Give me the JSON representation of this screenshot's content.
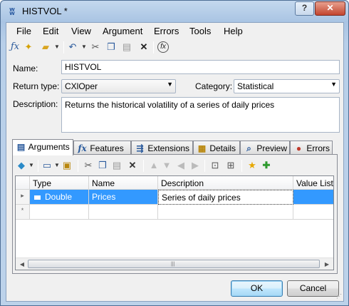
{
  "window": {
    "title": "HISTVOL *"
  },
  "titlebar_buttons": {
    "help": "?",
    "close": "✕"
  },
  "menu": [
    "File",
    "Edit",
    "View",
    "Argument",
    "Errors",
    "Tools",
    "Help"
  ],
  "form": {
    "name_label": "Name:",
    "name_value": "HISTVOL",
    "return_type_label": "Return type:",
    "return_type_value": "CXlOper",
    "category_label": "Category:",
    "category_value": "Statistical",
    "description_label": "Description:",
    "description_value": "Returns the historical volatility of a series of daily prices"
  },
  "tabs": [
    "Arguments",
    "Features",
    "Extensions",
    "Details",
    "Preview",
    "Errors"
  ],
  "grid": {
    "columns": [
      "Type",
      "Name",
      "Description",
      "Value List"
    ],
    "rows": [
      {
        "type": "Double",
        "name": "Prices",
        "description": "Series of daily prices",
        "value_list": ""
      }
    ],
    "new_row_marker": "*"
  },
  "buttons": {
    "ok": "OK",
    "cancel": "Cancel"
  }
}
